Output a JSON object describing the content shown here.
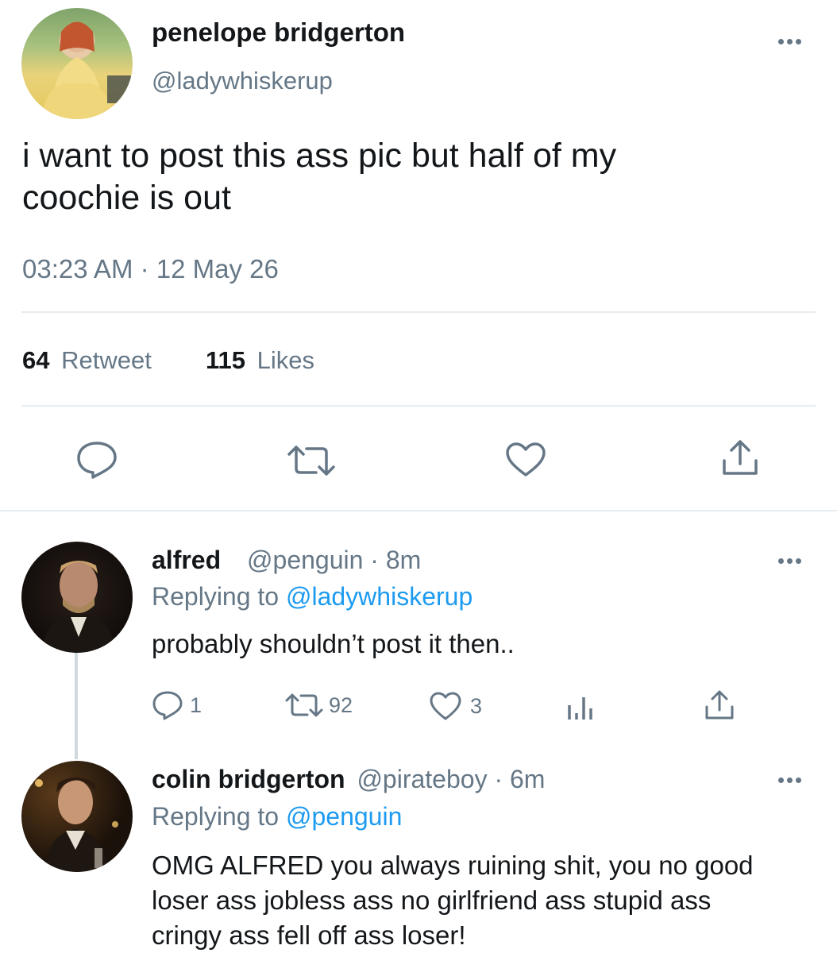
{
  "main_tweet": {
    "display_name": "penelope bridgerton",
    "handle": "@ladywhiskerup",
    "text": "i want to post this ass pic but half of my coochie is out",
    "timestamp": "03:23 AM · 12 May 26",
    "retweet_count": "64",
    "retweet_label": "Retweet",
    "like_count": "115",
    "like_label": "Likes"
  },
  "replies": [
    {
      "display_name": "alfred",
      "handle": "@penguin",
      "time": "· 8m",
      "replying_prefix": "Replying to",
      "replying_to": "@ladywhiskerup",
      "text": "probably shouldn’t post it then..",
      "reply_count": "1",
      "retweet_count": "92",
      "like_count": "3"
    },
    {
      "display_name": "colin bridgerton",
      "handle": "@pirateboy",
      "time": "· 6m",
      "replying_prefix": "Replying to",
      "replying_to": "@penguin",
      "text": "OMG ALFRED you always ruining shit, you no good loser ass jobless ass no girlfriend ass stupid ass cringy ass fell off ass loser!"
    }
  ],
  "icons": {
    "reply": "reply-icon",
    "retweet": "retweet-icon",
    "like": "heart-icon",
    "share": "share-icon",
    "analytics": "analytics-icon",
    "more": "more-icon"
  },
  "colors": {
    "text": "#14171a",
    "muted": "#657786",
    "link": "#1d9bf0",
    "divider": "#e6ecf0",
    "thread_line": "#cfd9de"
  }
}
